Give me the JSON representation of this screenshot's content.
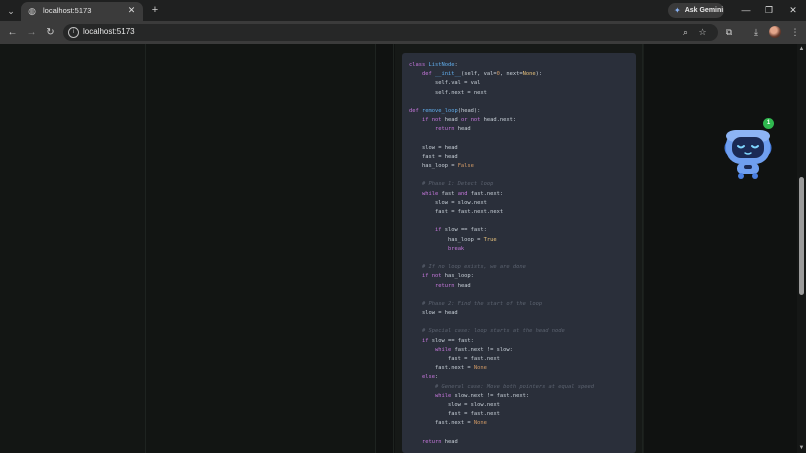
{
  "browser": {
    "tab": {
      "title": "localhost:5173"
    },
    "gemini_label": "Ask Gemini",
    "url": "localhost:5173"
  },
  "icons": {
    "tab_menu": "chevron-down-icon",
    "favicon": "globe-icon",
    "close": "close-icon",
    "new_tab": "plus-icon",
    "gemini": "sparkle-icon",
    "minimize": "minimize-icon",
    "maximize": "restore-icon",
    "window_close": "close-icon",
    "back": "arrow-left-icon",
    "forward": "arrow-right-icon",
    "reload": "reload-icon",
    "zoom": "zoom-icon",
    "bookmark": "star-icon",
    "extensions": "puzzle-icon",
    "downloads": "download-icon",
    "menu": "more-vert-icon"
  },
  "assistant": {
    "badge_count": "1"
  },
  "code": {
    "lines": [
      [
        [
          "kw",
          "class"
        ],
        [
          "t",
          " "
        ],
        [
          "fn",
          "ListNode"
        ],
        [
          "t",
          ":"
        ]
      ],
      [
        [
          "t",
          "    "
        ],
        [
          "kw",
          "def"
        ],
        [
          "t",
          " "
        ],
        [
          "fn",
          "__init__"
        ],
        [
          "t",
          "(self, val="
        ],
        [
          "num",
          "0"
        ],
        [
          "t",
          ", next="
        ],
        [
          "const",
          "None"
        ],
        [
          "t",
          "):"
        ]
      ],
      [
        [
          "t",
          "        self.val = val"
        ]
      ],
      [
        [
          "t",
          "        self.next = next"
        ]
      ],
      [],
      [
        [
          "kw",
          "def"
        ],
        [
          "t",
          " "
        ],
        [
          "fn",
          "remove_loop"
        ],
        [
          "t",
          "(head):"
        ]
      ],
      [
        [
          "t",
          "    "
        ],
        [
          "kw",
          "if not"
        ],
        [
          "t",
          " head "
        ],
        [
          "kw",
          "or not"
        ],
        [
          "t",
          " head.next:"
        ]
      ],
      [
        [
          "t",
          "        "
        ],
        [
          "kw",
          "return"
        ],
        [
          "t",
          " head"
        ]
      ],
      [],
      [
        [
          "t",
          "    slow = head"
        ]
      ],
      [
        [
          "t",
          "    fast = head"
        ]
      ],
      [
        [
          "t",
          "    has_loop = "
        ],
        [
          "num",
          "False"
        ]
      ],
      [],
      [
        [
          "t",
          "    "
        ],
        [
          "cm",
          "# Phase 1: Detect loop"
        ]
      ],
      [
        [
          "t",
          "    "
        ],
        [
          "kw",
          "while"
        ],
        [
          "t",
          " fast "
        ],
        [
          "kw",
          "and"
        ],
        [
          "t",
          " fast.next:"
        ]
      ],
      [
        [
          "t",
          "        slow = slow.next"
        ]
      ],
      [
        [
          "t",
          "        fast = fast.next.next"
        ]
      ],
      [],
      [
        [
          "t",
          "        "
        ],
        [
          "kw",
          "if"
        ],
        [
          "t",
          " slow == fast:"
        ]
      ],
      [
        [
          "t",
          "            has_loop = "
        ],
        [
          "const",
          "True"
        ]
      ],
      [
        [
          "t",
          "            "
        ],
        [
          "kw",
          "break"
        ]
      ],
      [],
      [
        [
          "t",
          "    "
        ],
        [
          "cm",
          "# If no loop exists, we are done"
        ]
      ],
      [
        [
          "t",
          "    "
        ],
        [
          "kw",
          "if not"
        ],
        [
          "t",
          " has_loop:"
        ]
      ],
      [
        [
          "t",
          "        "
        ],
        [
          "kw",
          "return"
        ],
        [
          "t",
          " head"
        ]
      ],
      [],
      [
        [
          "t",
          "    "
        ],
        [
          "cm",
          "# Phase 2: Find the start of the loop"
        ]
      ],
      [
        [
          "t",
          "    slow = head"
        ]
      ],
      [],
      [
        [
          "t",
          "    "
        ],
        [
          "cm",
          "# Special case: loop starts at the head node"
        ]
      ],
      [
        [
          "t",
          "    "
        ],
        [
          "kw",
          "if"
        ],
        [
          "t",
          " slow == fast:"
        ]
      ],
      [
        [
          "t",
          "        "
        ],
        [
          "kw",
          "while"
        ],
        [
          "t",
          " fast.next != slow:"
        ]
      ],
      [
        [
          "t",
          "            fast = fast.next"
        ]
      ],
      [
        [
          "t",
          "        fast.next = "
        ],
        [
          "num",
          "None"
        ]
      ],
      [
        [
          "t",
          "    "
        ],
        [
          "kw",
          "else"
        ],
        [
          "t",
          ":"
        ]
      ],
      [
        [
          "t",
          "        "
        ],
        [
          "cm",
          "# General case: Move both pointers at equal speed"
        ]
      ],
      [
        [
          "t",
          "        "
        ],
        [
          "kw",
          "while"
        ],
        [
          "t",
          " slow.next != fast.next:"
        ]
      ],
      [
        [
          "t",
          "            slow = slow.next"
        ]
      ],
      [
        [
          "t",
          "            fast = fast.next"
        ]
      ],
      [
        [
          "t",
          "        fast.next = "
        ],
        [
          "num",
          "None"
        ]
      ],
      [],
      [
        [
          "t",
          "    "
        ],
        [
          "kw",
          "return"
        ],
        [
          "t",
          " head"
        ]
      ]
    ]
  }
}
